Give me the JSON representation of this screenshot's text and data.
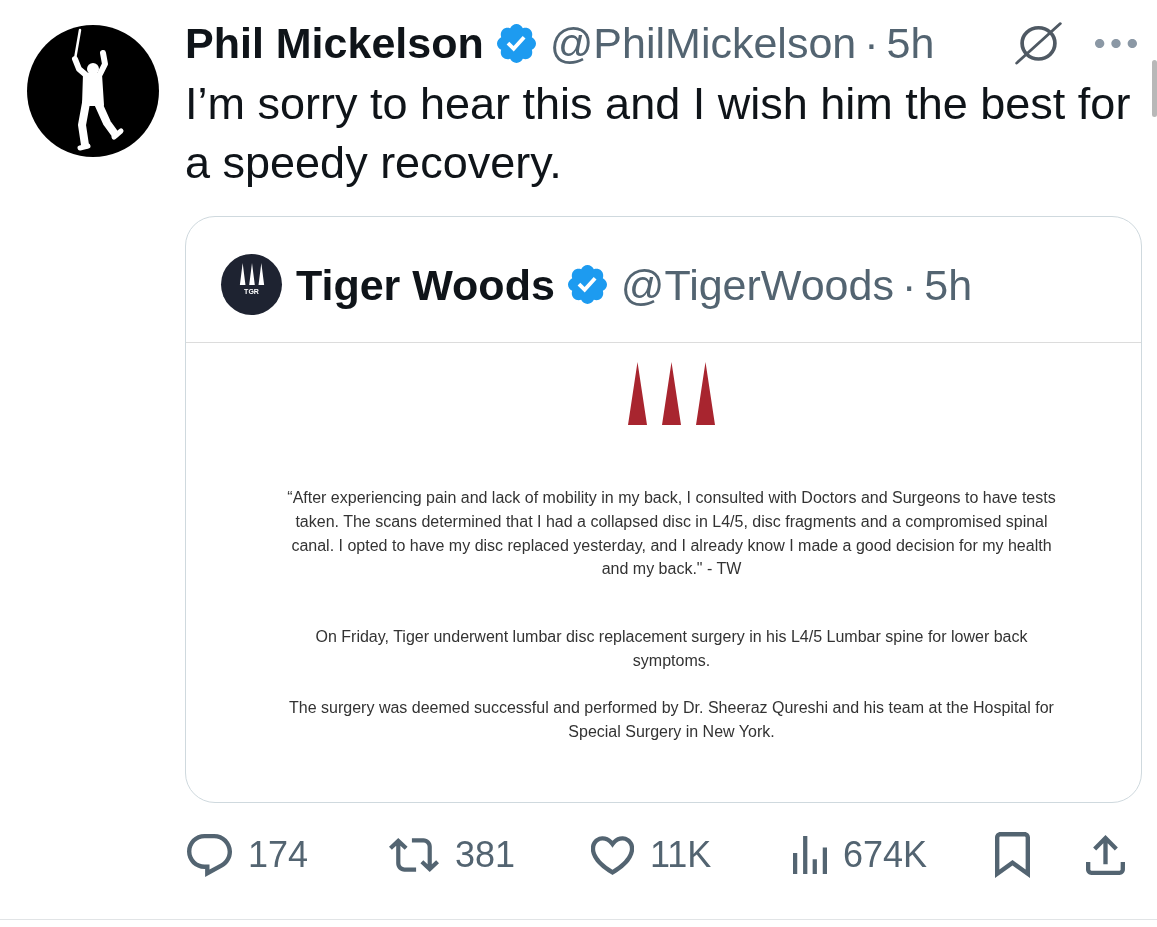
{
  "post": {
    "author": {
      "name": "Phil Mickelson",
      "verified": true,
      "handle": "@PhilMickelson",
      "separator": "·",
      "time": "5h"
    },
    "text": "I’m sorry to hear this and I wish him the best for a speedy recovery.",
    "quote": {
      "author": {
        "avatar_text": "TGR",
        "name": "Tiger Woods",
        "verified": true,
        "handle": "@TigerWoods",
        "separator": "·",
        "time": "5h"
      },
      "image": {
        "paragraphs": [
          "“After experiencing pain and lack of mobility in my back, I consulted with Doctors and Surgeons to have tests\ntaken. The scans determined that I had a collapsed disc in L4/5, disc fragments and a compromised spinal\ncanal. I opted to have my disc replaced yesterday, and I already know I made a good decision for my health\nand my back.\" - TW",
          "On Friday, Tiger underwent lumbar disc replacement surgery in his L4/5 Lumbar spine for lower back\nsymptoms.",
          "The surgery was deemed successful and performed by Dr. Sheeraz Qureshi and his team at the Hospital for\nSpecial Surgery in New York."
        ]
      }
    },
    "actions": [
      {
        "kind": "reply",
        "count": "174"
      },
      {
        "kind": "repost",
        "count": "381"
      },
      {
        "kind": "like",
        "count": "11K"
      },
      {
        "kind": "views",
        "count": "674K"
      },
      {
        "kind": "bookmark"
      },
      {
        "kind": "share"
      }
    ]
  }
}
